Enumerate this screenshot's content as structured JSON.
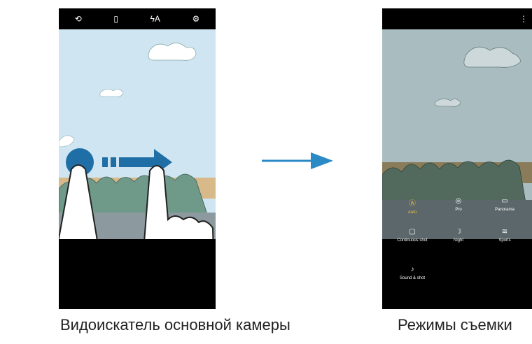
{
  "left_phone": {
    "top_icons": [
      "camera-switch-icon",
      "aspect-ratio-icon",
      "flash-auto-icon",
      "settings-gear-icon"
    ],
    "top_glyphs": [
      "⟲",
      "▯",
      "ϟA",
      "⚙"
    ]
  },
  "right_phone": {
    "menu_glyph": "⋮",
    "modes": [
      {
        "label": "Auto",
        "icon": "auto-mode-icon",
        "glyph": "Ⓐ"
      },
      {
        "label": "Pro",
        "icon": "pro-mode-icon",
        "glyph": "◎"
      },
      {
        "label": "Panorama",
        "icon": "panorama-icon",
        "glyph": "▭"
      },
      {
        "label": "Continuous shot",
        "icon": "continuous-shot-icon",
        "glyph": "▢"
      },
      {
        "label": "Night",
        "icon": "night-moon-icon",
        "glyph": "☽"
      },
      {
        "label": "Sports",
        "icon": "sports-icon",
        "glyph": "≋"
      },
      {
        "label": "Sound & shot",
        "icon": "sound-shot-icon",
        "glyph": "♪"
      }
    ]
  },
  "captions": {
    "left": "Видоискатель основной камеры",
    "right": "Режимы съемки"
  }
}
